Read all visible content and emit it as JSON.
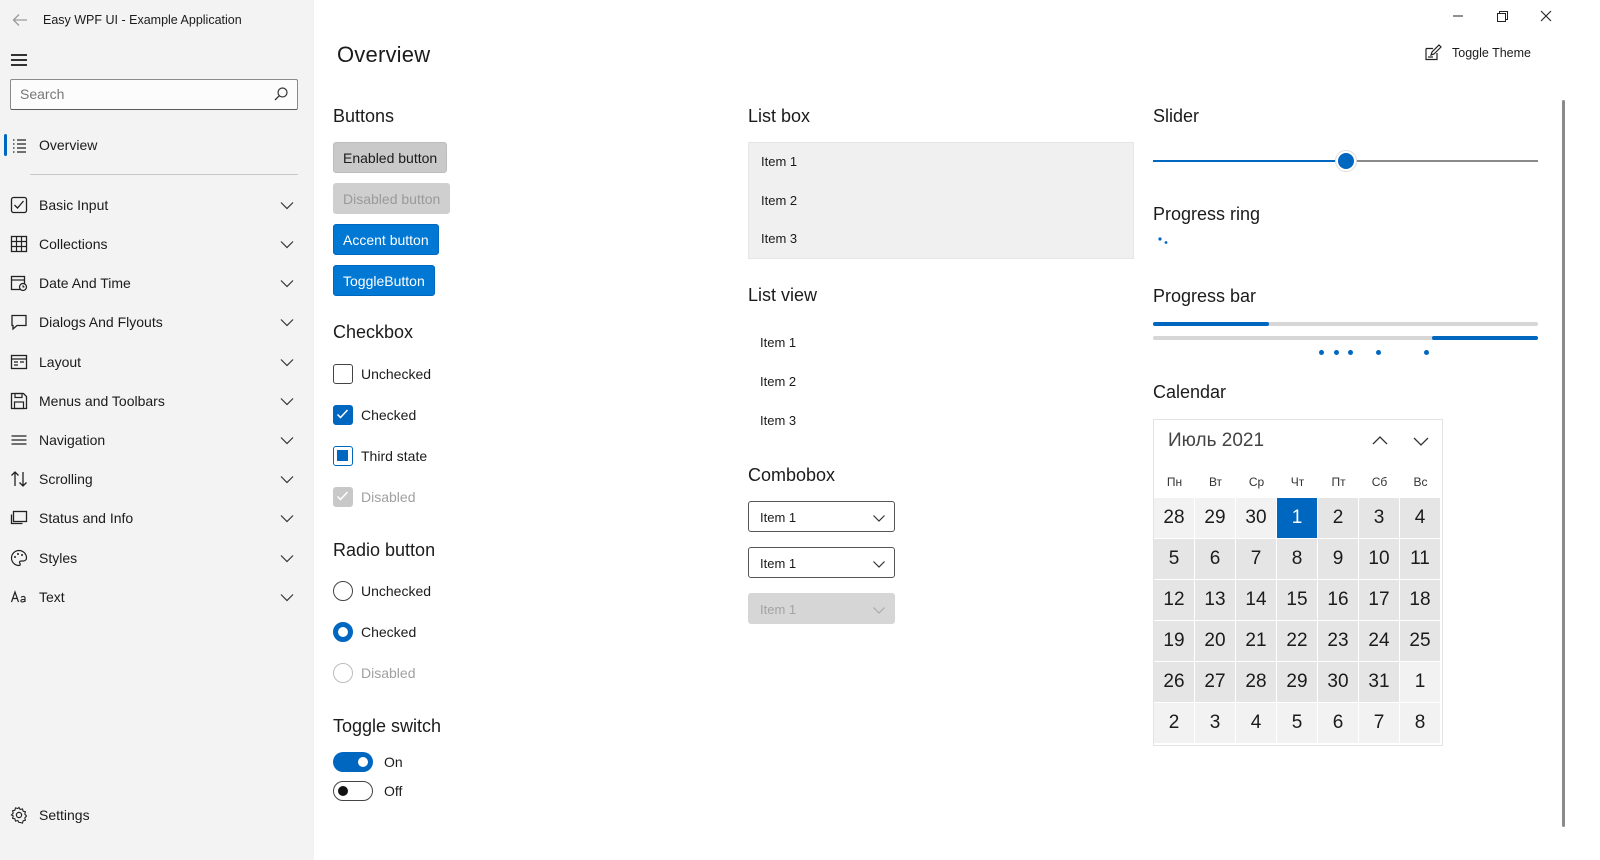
{
  "window": {
    "title": "Easy WPF UI - Example Application"
  },
  "search": {
    "placeholder": "Search"
  },
  "sidebar": {
    "items": [
      {
        "label": "Overview",
        "icon": "list-icon"
      },
      {
        "label": "Basic Input",
        "icon": "checkbox-icon"
      },
      {
        "label": "Collections",
        "icon": "grid-icon"
      },
      {
        "label": "Date And Time",
        "icon": "calendar-clock-icon"
      },
      {
        "label": "Dialogs And Flyouts",
        "icon": "chat-bubble-icon"
      },
      {
        "label": "Layout",
        "icon": "layout-icon"
      },
      {
        "label": "Menus and Toolbars",
        "icon": "save-icon"
      },
      {
        "label": "Navigation",
        "icon": "hamburger-icon"
      },
      {
        "label": "Scrolling",
        "icon": "sort-arrows-icon"
      },
      {
        "label": "Status and Info",
        "icon": "window-icon"
      },
      {
        "label": "Styles",
        "icon": "palette-icon"
      },
      {
        "label": "Text",
        "icon": "text-icon"
      }
    ],
    "settings_label": "Settings",
    "active_index": 0,
    "accent": "#0067c0"
  },
  "header": {
    "page_title": "Overview",
    "toggle_theme_label": "Toggle Theme"
  },
  "buttons": {
    "section": "Buttons",
    "enabled": "Enabled button",
    "disabled": "Disabled button",
    "accent": "Accent button",
    "toggle": "ToggleButton"
  },
  "checkbox": {
    "section": "Checkbox",
    "unchecked": "Unchecked",
    "checked": "Checked",
    "third": "Third state",
    "disabled": "Disabled"
  },
  "radio": {
    "section": "Radio button",
    "unchecked": "Unchecked",
    "checked": "Checked",
    "disabled": "Disabled"
  },
  "toggle_switch": {
    "section": "Toggle switch",
    "on": "On",
    "off": "Off"
  },
  "listbox": {
    "section": "List box",
    "items": [
      "Item 1",
      "Item 2",
      "Item 3"
    ]
  },
  "listview": {
    "section": "List view",
    "items": [
      "Item 1",
      "Item 2",
      "Item 3"
    ]
  },
  "combobox": {
    "section": "Combobox",
    "values": [
      "Item 1",
      "Item 1",
      "Item 1"
    ]
  },
  "slider": {
    "section": "Slider",
    "value": 0.5
  },
  "progress_ring": {
    "section": "Progress ring"
  },
  "progress_bar": {
    "section": "Progress bar",
    "value": 0.3
  },
  "calendar": {
    "section": "Calendar",
    "month_label": "Июль 2021",
    "weekdays": [
      "Пн",
      "Вт",
      "Ср",
      "Чт",
      "Пт",
      "Сб",
      "Вс"
    ],
    "weeks": [
      [
        "28",
        "29",
        "30",
        "1",
        "2",
        "3",
        "4"
      ],
      [
        "5",
        "6",
        "7",
        "8",
        "9",
        "10",
        "11"
      ],
      [
        "12",
        "13",
        "14",
        "15",
        "16",
        "17",
        "18"
      ],
      [
        "19",
        "20",
        "21",
        "22",
        "23",
        "24",
        "25"
      ],
      [
        "26",
        "27",
        "28",
        "29",
        "30",
        "31",
        "1"
      ],
      [
        "2",
        "3",
        "4",
        "5",
        "6",
        "7",
        "8"
      ]
    ],
    "selected": "1"
  }
}
